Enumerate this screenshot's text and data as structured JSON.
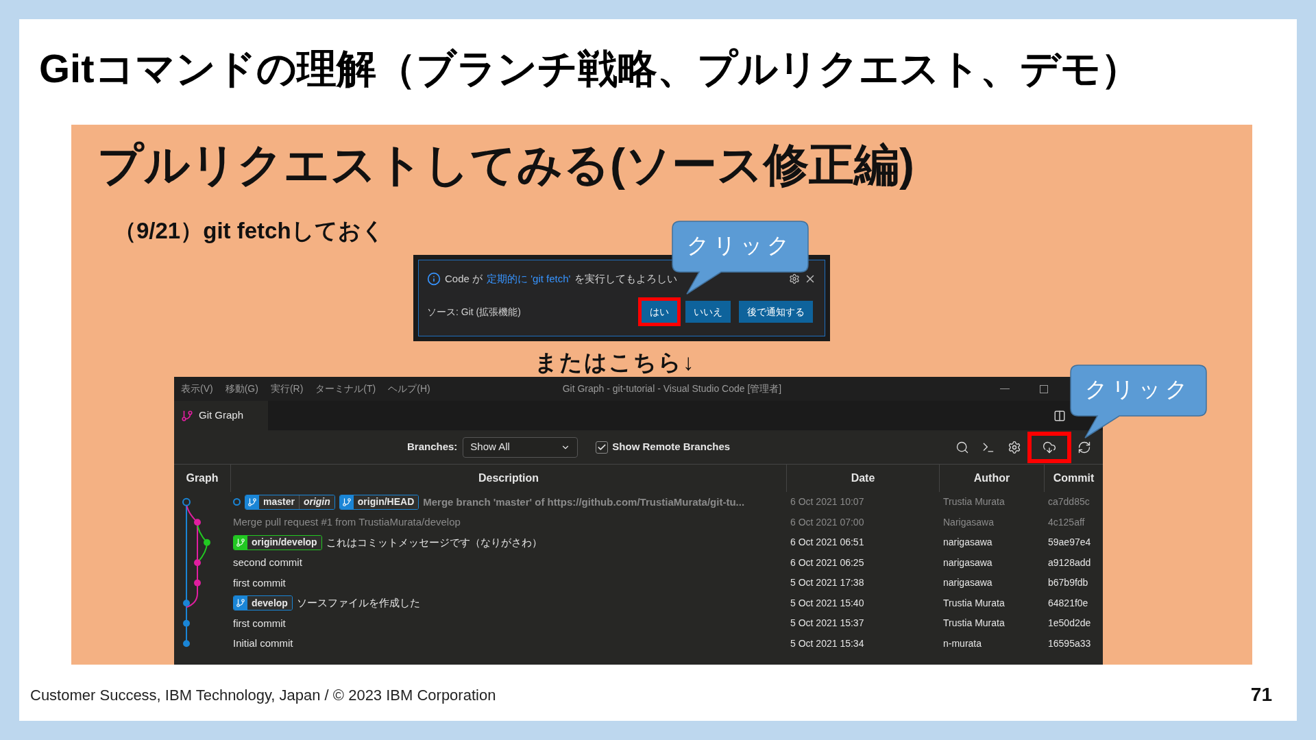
{
  "slide": {
    "title": "Gitコマンドの理解（ブランチ戦略、プルリクエスト、デモ）",
    "heading": "プルリクエストしてみる(ソース修正編)",
    "step": "（9/21）git fetchしておく",
    "alternative": "またはこちら↓",
    "footer": "Customer Success, IBM Technology, Japan / © 2023 IBM Corporation",
    "page_number": "71"
  },
  "notification": {
    "message_before": "Code が",
    "link": "定期的に 'git fetch'",
    "message_after": "を実行してもよろしい",
    "source": "ソース: Git (拡張機能)",
    "buttons": [
      {
        "label": "はい",
        "highlighted": true
      },
      {
        "label": "いいえ",
        "highlighted": false
      },
      {
        "label": "後で通知する",
        "highlighted": false
      }
    ]
  },
  "callouts": [
    {
      "text": "クリック"
    },
    {
      "text": "クリック"
    }
  ],
  "window": {
    "menu": [
      "表示(V)",
      "移動(G)",
      "実行(R)",
      "ターミナル(T)",
      "ヘルプ(H)"
    ],
    "title": "Git Graph - git-tutorial - Visual Studio Code [管理者]",
    "tab": "Git Graph"
  },
  "toolbar": {
    "branches_label": "Branches:",
    "branches_value": "Show All",
    "remote_branches": {
      "label": "Show Remote Branches",
      "checked": true
    },
    "actions": [
      {
        "kind": "search",
        "highlighted": false
      },
      {
        "kind": "terminal",
        "highlighted": false
      },
      {
        "kind": "settings",
        "highlighted": false
      },
      {
        "kind": "fetch",
        "highlighted": true
      },
      {
        "kind": "refresh",
        "highlighted": false
      }
    ]
  },
  "table": {
    "columns": [
      "Graph",
      "Description",
      "Date",
      "Author",
      "Commit"
    ],
    "rows": [
      {
        "head": true,
        "muted": true,
        "refs": [
          {
            "name": "master",
            "remote": "origin",
            "color": "#1a85d6"
          },
          {
            "name": "origin/HEAD",
            "color": "#1a85d6"
          }
        ],
        "description": "Merge branch 'master' of https://github.com/TrustiaMurata/git-tu...",
        "date": "6 Oct 2021 10:07",
        "author": "Trustia Murata",
        "commit": "ca7dd85c"
      },
      {
        "head": false,
        "muted": true,
        "description": "Merge pull request #1 from TrustiaMurata/develop",
        "date": "6 Oct 2021 07:00",
        "author": "Narigasawa",
        "commit": "4c125aff"
      },
      {
        "head": false,
        "muted": false,
        "refs": [
          {
            "name": "origin/develop",
            "color": "#22c822"
          }
        ],
        "description": "これはコミットメッセージです（なりがさわ）",
        "date": "6 Oct 2021 06:51",
        "author": "narigasawa",
        "commit": "59ae97e4"
      },
      {
        "head": false,
        "muted": false,
        "description": "second commit",
        "date": "6 Oct 2021 06:25",
        "author": "narigasawa",
        "commit": "a9128add"
      },
      {
        "head": false,
        "muted": false,
        "description": "first commit",
        "date": "5 Oct 2021 17:38",
        "author": "narigasawa",
        "commit": "b67b9fdb"
      },
      {
        "head": false,
        "muted": false,
        "refs": [
          {
            "name": "develop",
            "color": "#1a85d6"
          }
        ],
        "description": "ソースファイルを作成した",
        "date": "5 Oct 2021 15:40",
        "author": "Trustia Murata",
        "commit": "64821f0e"
      },
      {
        "head": false,
        "muted": false,
        "description": "first commit",
        "date": "5 Oct 2021 15:37",
        "author": "Trustia Murata",
        "commit": "1e50d2de"
      },
      {
        "head": false,
        "muted": false,
        "description": "Initial commit",
        "date": "5 Oct 2021 15:34",
        "author": "n-murata",
        "commit": "16595a33"
      }
    ]
  }
}
